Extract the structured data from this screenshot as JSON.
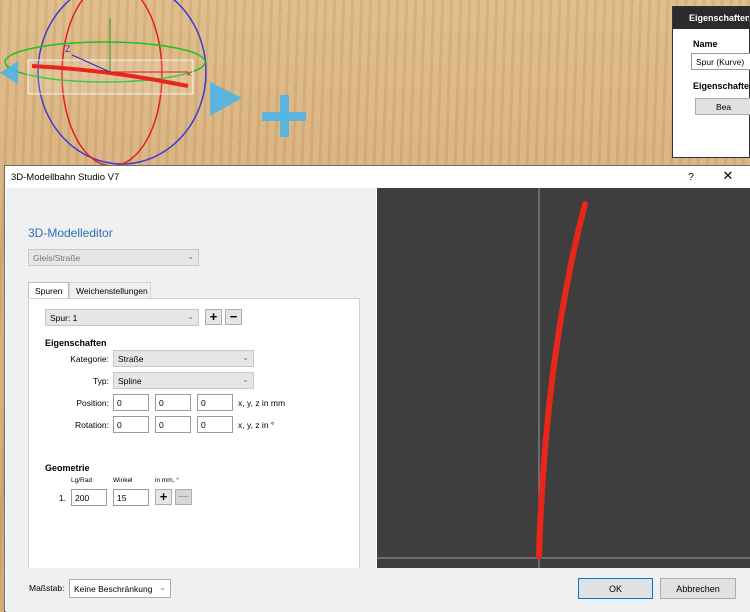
{
  "colors": {
    "accent": "#2e6fbd",
    "spline": "#e8261a",
    "viewport": "#3e3e3e",
    "ok_border": "#0078d7"
  },
  "scene": {
    "axis_label_z": "Z",
    "axis_label_x": "×"
  },
  "properties": {
    "title": "Eigenschaften",
    "name_label": "Name",
    "name_value": "Spur (Kurve)",
    "section_label": "Eigenschaften",
    "button_label": "Bea"
  },
  "dialog": {
    "title": "3D-Modellbahn Studio V7",
    "help_label": "?",
    "close_label": "✕",
    "heading": "3D-Modelleditor",
    "type_select": "Gleis/Straße",
    "tabs": [
      {
        "label": "Spuren"
      },
      {
        "label": "Weichenstellungen"
      }
    ],
    "track_select": "Spur: 1",
    "add_label": "+",
    "remove_label": "−",
    "props_heading": "Eigenschaften",
    "category_label": "Kategorie:",
    "category_value": "Straße",
    "type_label": "Typ:",
    "type_value": "Spline",
    "position_label": "Position:",
    "position": [
      "0",
      "0",
      "0"
    ],
    "position_unit": "x, y, z in mm",
    "rotation_label": "Rotation:",
    "rotation": [
      "0",
      "0",
      "0"
    ],
    "rotation_unit": "x, y, z in °",
    "geometry_heading": "Geometrie",
    "col_len": "Lg/Rad",
    "col_angle": "Winkel",
    "col_unit": "in mm, °",
    "rows": [
      {
        "index": "1.",
        "length": "200",
        "angle": "15"
      }
    ],
    "row_add": "+",
    "row_remove": "––",
    "scale_label": "Maßstab:",
    "scale_value": "Keine Beschränkung",
    "ok_label": "OK",
    "cancel_label": "Abbrechen"
  }
}
